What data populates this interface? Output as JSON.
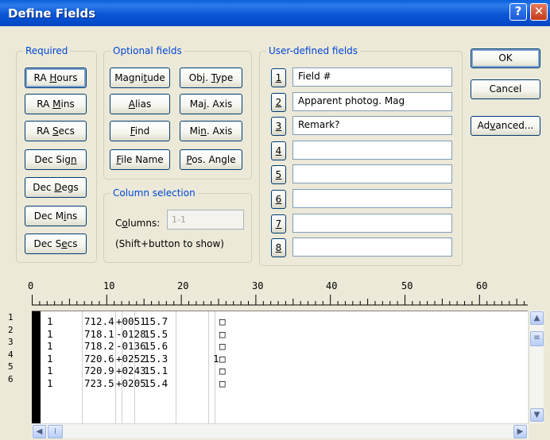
{
  "window": {
    "title": "Define Fields",
    "help_glyph": "?",
    "close_glyph": "✕"
  },
  "required": {
    "label": "Required",
    "buttons": [
      {
        "pre": "RA ",
        "u": "H",
        "post": "ours"
      },
      {
        "pre": "RA ",
        "u": "M",
        "post": "ins"
      },
      {
        "pre": "RA ",
        "u": "S",
        "post": "ecs"
      },
      {
        "pre": "Dec Sig",
        "u": "n",
        "post": ""
      },
      {
        "pre": "Dec ",
        "u": "D",
        "post": "egs"
      },
      {
        "pre": "Dec M",
        "u": "i",
        "post": "ns"
      },
      {
        "pre": "Dec S",
        "u": "e",
        "post": "cs"
      }
    ]
  },
  "optional": {
    "label": "Optional fields",
    "buttons": [
      {
        "pre": "Magni",
        "u": "t",
        "post": "ude"
      },
      {
        "pre": "Obj. ",
        "u": "T",
        "post": "ype"
      },
      {
        "pre": "",
        "u": "A",
        "post": "lias"
      },
      {
        "pre": "Ma",
        "u": "j",
        "post": ". Axis"
      },
      {
        "pre": "",
        "u": "F",
        "post": "ind"
      },
      {
        "pre": "Mi",
        "u": "n",
        "post": ". Axis"
      },
      {
        "pre": "",
        "u": "F",
        "post": "ile Name"
      },
      {
        "pre": "",
        "u": "P",
        "post": "os. Angle"
      }
    ]
  },
  "column_selection": {
    "label": "Column selection",
    "columns_pre": "C",
    "columns_u": "o",
    "columns_post": "lumns:",
    "columns_value": "1-1",
    "hint": "(Shift+button to show)"
  },
  "user_defined": {
    "label": "User-defined fields",
    "fields": [
      {
        "num": "1",
        "value": "Field #"
      },
      {
        "num": "2",
        "value": "Apparent photog. Mag"
      },
      {
        "num": "3",
        "value": "Remark?"
      },
      {
        "num": "4",
        "value": ""
      },
      {
        "num": "5",
        "value": ""
      },
      {
        "num": "6",
        "value": ""
      },
      {
        "num": "7",
        "value": ""
      },
      {
        "num": "8",
        "value": ""
      }
    ]
  },
  "actions": {
    "ok": "OK",
    "cancel": "Cancel",
    "advanced_pre": "Ad",
    "advanced_u": "v",
    "advanced_post": "anced..."
  },
  "ruler": {
    "labels": [
      "0",
      "10",
      "20",
      "30",
      "40",
      "50",
      "60"
    ]
  },
  "data_rows": [
    {
      "line": "1",
      "field": "1",
      "ra": "712.4",
      "dec": "+0051",
      "mag": "15.7",
      "remark": "",
      "box": "□"
    },
    {
      "line": "2",
      "field": "1",
      "ra": "718.1",
      "dec": "-0128",
      "mag": "15.5",
      "remark": "",
      "box": "□"
    },
    {
      "line": "3",
      "field": "1",
      "ra": "718.2",
      "dec": "-0136",
      "mag": "15.6",
      "remark": "",
      "box": "□"
    },
    {
      "line": "4",
      "field": "1",
      "ra": "720.6",
      "dec": "+0252",
      "mag": "15.3",
      "remark": "1",
      "box": "□"
    },
    {
      "line": "5",
      "field": "1",
      "ra": "720.9",
      "dec": "+0243",
      "mag": "15.1",
      "remark": "",
      "box": "□"
    },
    {
      "line": "6",
      "field": "1",
      "ra": "723.5",
      "dec": "+0205",
      "mag": "15.4",
      "remark": "",
      "box": "□"
    }
  ]
}
